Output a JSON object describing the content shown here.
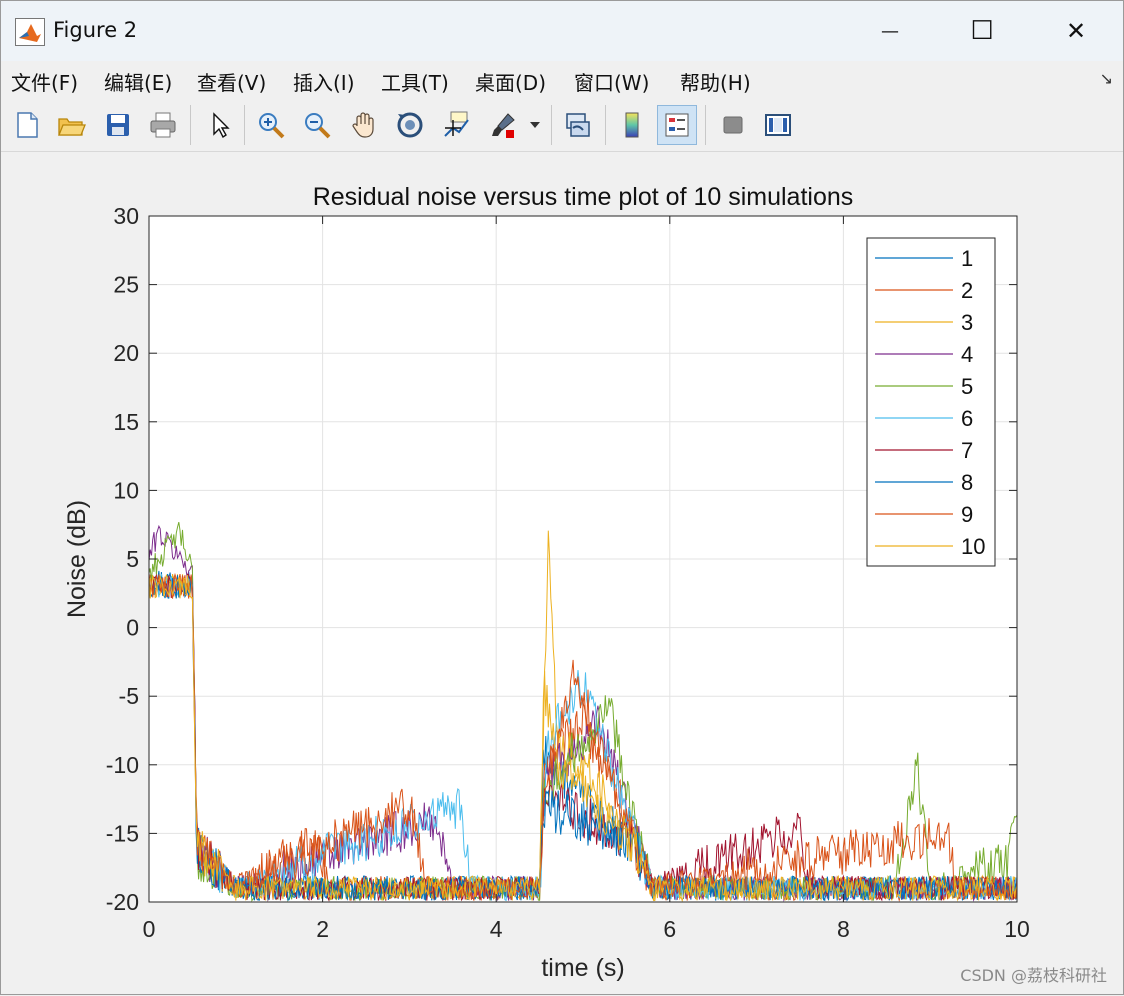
{
  "window": {
    "title": "Figure 2",
    "minimize_glyph": "—",
    "maximize_glyph": "☐",
    "close_glyph": "✕"
  },
  "menu": {
    "items": [
      "文件(F)",
      "编辑(E)",
      "查看(V)",
      "插入(I)",
      "工具(T)",
      "桌面(D)",
      "窗口(W)",
      "帮助(H)"
    ],
    "overflow_glyph": "↘"
  },
  "toolbar": {
    "buttons": [
      {
        "name": "new-figure-icon"
      },
      {
        "name": "open-file-icon"
      },
      {
        "name": "save-icon"
      },
      {
        "name": "print-icon"
      },
      {
        "name": "edit-plot-arrow-icon"
      },
      {
        "name": "zoom-in-icon"
      },
      {
        "name": "zoom-out-icon"
      },
      {
        "name": "pan-hand-icon"
      },
      {
        "name": "rotate-3d-icon"
      },
      {
        "name": "data-cursor-icon"
      },
      {
        "name": "brush-icon"
      },
      {
        "name": "link-plot-icon"
      },
      {
        "name": "colorbar-icon"
      },
      {
        "name": "legend-icon"
      },
      {
        "name": "hide-plot-tools-icon"
      },
      {
        "name": "show-plot-tools-icon"
      }
    ]
  },
  "chart_data": {
    "type": "line",
    "title": "Residual noise versus time plot of 10 simulations",
    "xlabel": "time (s)",
    "ylabel": "Noise (dB)",
    "xlim": [
      0,
      10
    ],
    "ylim": [
      -20,
      30
    ],
    "xticks": [
      "0",
      "2",
      "4",
      "6",
      "8",
      "10"
    ],
    "yticks": [
      "-20",
      "-15",
      "-10",
      "-5",
      "0",
      "5",
      "10",
      "15",
      "20",
      "25",
      "30"
    ],
    "grid": true,
    "legend_position": "top-right",
    "series": [
      {
        "name": "1",
        "color": "#0072BD",
        "events": [
          [
            0.0,
            3.5
          ],
          [
            0.5,
            3.5
          ],
          [
            0.55,
            -16
          ],
          [
            1.0,
            -19
          ],
          [
            4.5,
            -19
          ],
          [
            4.55,
            -9
          ],
          [
            4.9,
            -12
          ],
          [
            5.6,
            -16
          ],
          [
            5.8,
            -19
          ],
          [
            10,
            -19
          ]
        ]
      },
      {
        "name": "2",
        "color": "#D95319",
        "events": [
          [
            0.0,
            3
          ],
          [
            0.5,
            3
          ],
          [
            0.55,
            -16
          ],
          [
            1.0,
            -19
          ],
          [
            1.9,
            -15.5
          ],
          [
            2.1,
            -19
          ],
          [
            4.5,
            -19
          ],
          [
            4.55,
            -10
          ],
          [
            5.0,
            -7
          ],
          [
            5.6,
            -15
          ],
          [
            5.8,
            -19
          ],
          [
            10,
            -19
          ]
        ]
      },
      {
        "name": "3",
        "color": "#EDB120",
        "events": [
          [
            0.0,
            3
          ],
          [
            0.5,
            3
          ],
          [
            0.55,
            -16
          ],
          [
            1.0,
            -19
          ],
          [
            4.5,
            -19
          ],
          [
            4.6,
            6.5
          ],
          [
            4.7,
            -8
          ],
          [
            5.0,
            -10
          ],
          [
            5.6,
            -16
          ],
          [
            5.8,
            -19
          ],
          [
            10,
            -19
          ]
        ]
      },
      {
        "name": "4",
        "color": "#7E2F8E",
        "events": [
          [
            0.0,
            5
          ],
          [
            0.1,
            7
          ],
          [
            0.5,
            4
          ],
          [
            0.55,
            -16
          ],
          [
            1.0,
            -19
          ],
          [
            3.3,
            -14
          ],
          [
            3.5,
            -19
          ],
          [
            4.5,
            -19
          ],
          [
            4.55,
            -11
          ],
          [
            5.2,
            -7
          ],
          [
            5.6,
            -15
          ],
          [
            5.8,
            -19
          ],
          [
            10,
            -19
          ]
        ]
      },
      {
        "name": "5",
        "color": "#77AC30",
        "events": [
          [
            0.0,
            4
          ],
          [
            0.35,
            7
          ],
          [
            0.5,
            4
          ],
          [
            0.55,
            -17
          ],
          [
            1.0,
            -19
          ],
          [
            4.5,
            -19
          ],
          [
            4.55,
            -12
          ],
          [
            5.3,
            -5.5
          ],
          [
            5.7,
            -17
          ],
          [
            5.8,
            -19
          ],
          [
            8.6,
            -19
          ],
          [
            8.85,
            -10
          ],
          [
            9.0,
            -19
          ],
          [
            9.9,
            -17
          ],
          [
            10,
            -13.5
          ]
        ]
      },
      {
        "name": "6",
        "color": "#4DBEEE",
        "events": [
          [
            0.0,
            3
          ],
          [
            0.5,
            3
          ],
          [
            0.55,
            -16
          ],
          [
            1.0,
            -19
          ],
          [
            3.6,
            -13
          ],
          [
            3.7,
            -19
          ],
          [
            4.5,
            -19
          ],
          [
            4.6,
            -8
          ],
          [
            5.0,
            -4
          ],
          [
            5.6,
            -15
          ],
          [
            5.8,
            -19
          ],
          [
            10,
            -19
          ]
        ]
      },
      {
        "name": "7",
        "color": "#A2142F",
        "events": [
          [
            0.0,
            3
          ],
          [
            0.5,
            3
          ],
          [
            0.55,
            -16
          ],
          [
            1.0,
            -19
          ],
          [
            4.5,
            -19
          ],
          [
            4.55,
            -12
          ],
          [
            5.6,
            -16
          ],
          [
            5.8,
            -19
          ],
          [
            7.5,
            -14.5
          ],
          [
            7.6,
            -19
          ],
          [
            10,
            -19
          ]
        ]
      },
      {
        "name": "8",
        "color": "#0072BD",
        "events": [
          [
            0.0,
            3
          ],
          [
            0.5,
            3
          ],
          [
            0.55,
            -16
          ],
          [
            1.0,
            -19
          ],
          [
            4.5,
            -19
          ],
          [
            4.55,
            -13
          ],
          [
            5.6,
            -16
          ],
          [
            5.8,
            -19
          ],
          [
            10,
            -19
          ]
        ]
      },
      {
        "name": "9",
        "color": "#D95319",
        "events": [
          [
            0.0,
            3
          ],
          [
            0.5,
            3
          ],
          [
            0.55,
            -16
          ],
          [
            1.0,
            -19
          ],
          [
            3.0,
            -13
          ],
          [
            3.2,
            -19
          ],
          [
            4.5,
            -19
          ],
          [
            4.55,
            -12
          ],
          [
            4.9,
            -3
          ],
          [
            5.6,
            -16
          ],
          [
            5.8,
            -19
          ],
          [
            9.2,
            -15
          ],
          [
            9.3,
            -19
          ],
          [
            10,
            -19
          ]
        ]
      },
      {
        "name": "10",
        "color": "#EDB120",
        "events": [
          [
            0.0,
            3
          ],
          [
            0.5,
            3
          ],
          [
            0.55,
            -16
          ],
          [
            1.0,
            -19
          ],
          [
            4.5,
            -19
          ],
          [
            4.55,
            -4
          ],
          [
            4.7,
            -10
          ],
          [
            5.6,
            -16
          ],
          [
            5.8,
            -19
          ],
          [
            10,
            -19
          ]
        ]
      }
    ]
  },
  "watermark": "CSDN @荔枝科研社"
}
